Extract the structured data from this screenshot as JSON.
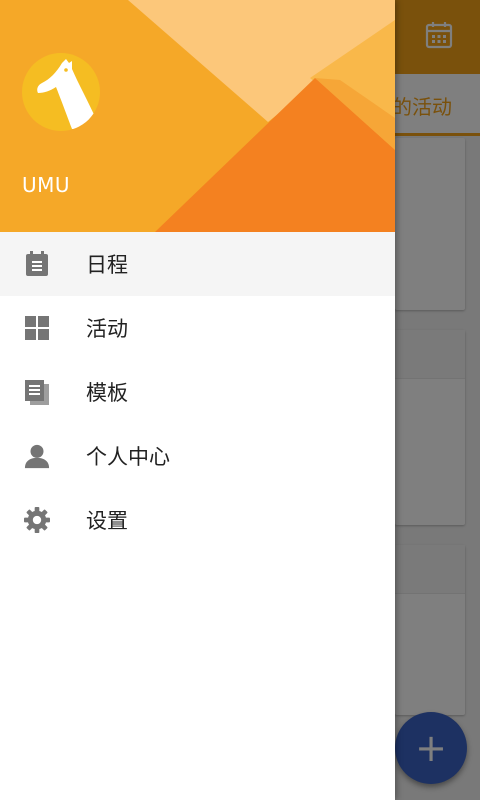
{
  "background": {
    "tab_label": "的活动",
    "fab_label": "+",
    "calendar_icon": "calendar-icon"
  },
  "drawer": {
    "username": "UMU",
    "avatar_icon": "giraffe-icon",
    "items": [
      {
        "label": "日程",
        "icon": "schedule-icon",
        "active": true
      },
      {
        "label": "活动",
        "icon": "grid-icon",
        "active": false
      },
      {
        "label": "模板",
        "icon": "template-icon",
        "active": false
      },
      {
        "label": "个人中心",
        "icon": "person-icon",
        "active": false
      },
      {
        "label": "设置",
        "icon": "gear-icon",
        "active": false
      }
    ]
  },
  "colors": {
    "brand_orange": "#f5a318",
    "fab_blue": "#3b63c4",
    "header_light": "#fcc77a",
    "header_dark": "#f48120"
  }
}
